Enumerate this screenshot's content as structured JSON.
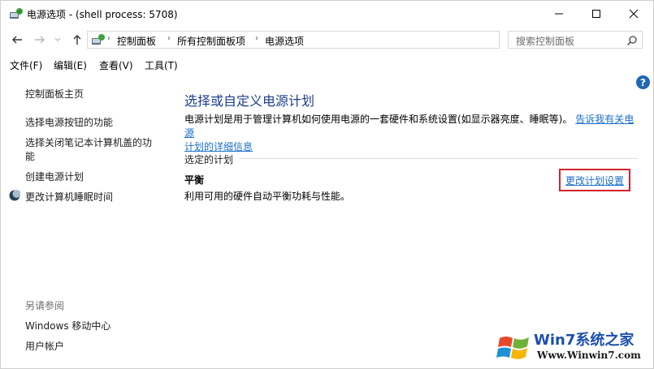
{
  "window": {
    "title": "电源选项 - (shell process: 5708)"
  },
  "address": {
    "crumbs": [
      "控制面板",
      "所有控制面板项",
      "电源选项"
    ]
  },
  "search": {
    "placeholder": "搜索控制面板"
  },
  "menu": {
    "items": [
      "文件(F)",
      "编辑(E)",
      "查看(V)",
      "工具(T)"
    ]
  },
  "sidebar": {
    "home": "控制面板主页",
    "links": [
      "选择电源按钮的功能",
      "选择关闭笔记本计算机盖的功",
      "能",
      "创建电源计划",
      "更改计算机睡眠时间"
    ],
    "see_also_label": "另请参阅",
    "see_also": [
      "Windows 移动中心",
      "用户帐户"
    ]
  },
  "main": {
    "title": "选择或自定义电源计划",
    "desc_line1": "电源计划是用于管理计算机如何使用电源的一套硬件和系统设置(如显示器亮度、睡眠等)。",
    "desc_link1": "告诉我有关电源",
    "desc_link2": "计划的详细信息",
    "selected_plan_label": "选定的计划",
    "plan_name": "平衡",
    "plan_description": "利用可用的硬件自动平衡功耗与性能。",
    "change_link": "更改计划设置"
  },
  "help": {
    "symbol": "?"
  },
  "watermark": {
    "title": "Win7系统之家",
    "url": "Www.Winwin7.com"
  },
  "colors": {
    "link": "#1a6fc7",
    "title": "#1d3e8c",
    "highlight_border": "#d4232a",
    "help": "#1f67b4"
  }
}
